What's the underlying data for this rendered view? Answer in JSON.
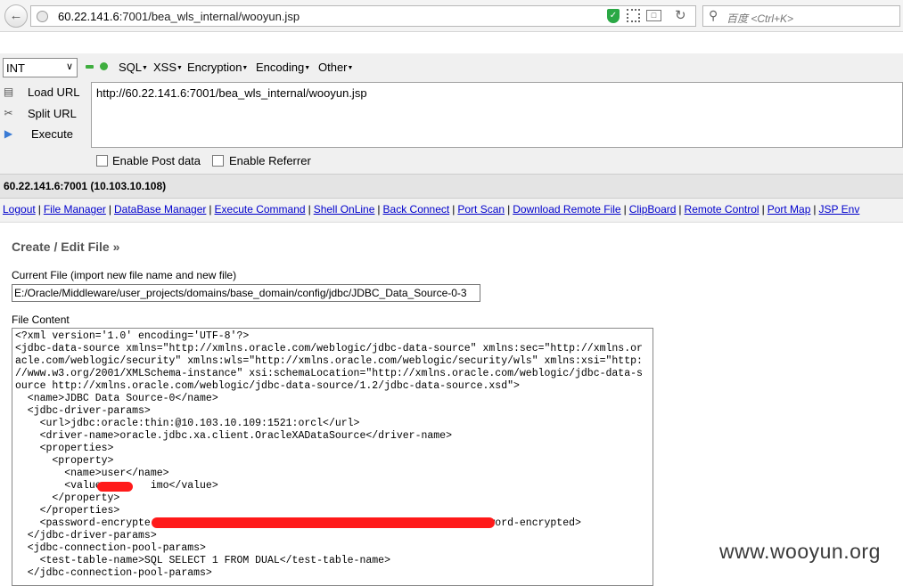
{
  "browser": {
    "url_host": "60.22.141.6",
    "url_rest": ":7001/bea_wls_internal/wooyun.jsp",
    "search_placeholder": "百度 <Ctrl+K>"
  },
  "hackbar": {
    "select_value": "INT",
    "menus": [
      "SQL",
      "XSS",
      "Encryption",
      "Encoding",
      "Other"
    ],
    "actions": {
      "load": "Load URL",
      "split": "Split URL",
      "execute": "Execute"
    },
    "url_value": "http://60.22.141.6:7001/bea_wls_internal/wooyun.jsp",
    "enable_post": "Enable Post data",
    "enable_referrer": "Enable Referrer"
  },
  "page": {
    "host": "60.22.141.6:7001 (10.103.10.108)",
    "nav": [
      "Logout",
      "File Manager",
      "DataBase Manager",
      "Execute Command",
      "Shell OnLine",
      "Back Connect",
      "Port Scan",
      "Download Remote File",
      "ClipBoard",
      "Remote Control",
      "Port Map",
      "JSP Env"
    ],
    "heading": "Create / Edit File »",
    "current_file_label": "Current File (import new file name and new file)",
    "current_file_value": "E:/Oracle/Middleware/user_projects/domains/base_domain/config/jdbc/JDBC_Data_Source-0-3",
    "file_content_label": "File Content",
    "file_lines": [
      "<?xml version='1.0' encoding='UTF-8'?>",
      "<jdbc-data-source xmlns=\"http://xmlns.oracle.com/weblogic/jdbc-data-source\" xmlns:sec=\"http://xmlns.or",
      "acle.com/weblogic/security\" xmlns:wls=\"http://xmlns.oracle.com/weblogic/security/wls\" xmlns:xsi=\"http:",
      "//www.w3.org/2001/XMLSchema-instance\" xsi:schemaLocation=\"http://xmlns.oracle.com/weblogic/jdbc-data-s",
      "ource http://xmlns.oracle.com/weblogic/jdbc-data-source/1.2/jdbc-data-source.xsd\">",
      "  <name>JDBC Data Source-0</name>",
      "  <jdbc-driver-params>",
      "    <url>jdbc:oracle:thin:@10.103.10.109:1521:orcl</url>",
      "    <driver-name>oracle.jdbc.xa.client.OracleXADataSource</driver-name>",
      "    <properties>",
      "      <property>",
      "        <name>user</name>",
      "        <value        imo</value>",
      "      </property>",
      "    </properties>",
      "    <password-encrypte                                                     ssword-encrypted>",
      "  </jdbc-driver-params>",
      "  <jdbc-connection-pool-params>",
      "    <test-table-name>SQL SELECT 1 FROM DUAL</test-table-name>",
      "  </jdbc-connection-pool-params>"
    ]
  },
  "watermark": "www.wooyun.org"
}
